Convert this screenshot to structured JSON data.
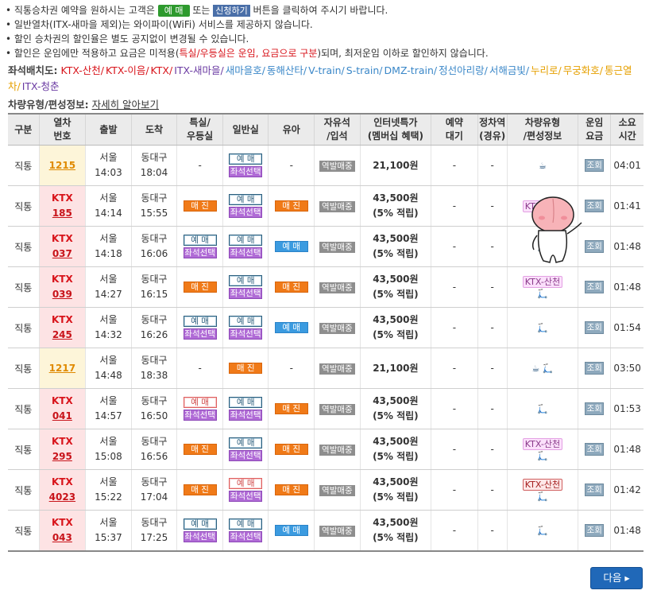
{
  "notices": [
    {
      "pre": "• 직통승차권 예약을 원하시는 고객은 ",
      "chip1": "예 매",
      "mid": " 또는 ",
      "chip2": "신청하기",
      "post": " 버튼을 클릭하여 주시기 바랍니다."
    },
    {
      "text": "• 일반열차(ITX-새마을 제외)는 와이파이(WiFi) 서비스를 제공하지 않습니다."
    },
    {
      "text": "• 할인 승차권의 할인율은 별도 공지없이 변경될 수 있습니다."
    },
    {
      "pre": "• 할인은 운임에만 적용하고 요금은 미적용(",
      "red": "특실/우등실은 운임, 요금으로 구분",
      "post": ")되며, 최저운임 이하로 할인하지 않습니다."
    }
  ],
  "seat_map": {
    "label": "좌석배치도:",
    "links": [
      {
        "text": "KTX-산천/",
        "color": "#d8131a"
      },
      {
        "text": "KTX-이음/",
        "color": "#d8131a"
      },
      {
        "text": "KTX/",
        "color": "#d8131a"
      },
      {
        "text": "ITX-새마을/",
        "color": "#6a3aa2"
      },
      {
        "text": "새마을호/",
        "color": "#3a87c8"
      },
      {
        "text": "동해산타/",
        "color": "#3a87c8"
      },
      {
        "text": "V-train/",
        "color": "#3a87c8"
      },
      {
        "text": "S-train/",
        "color": "#3a87c8"
      },
      {
        "text": "DMZ-train/",
        "color": "#3a87c8"
      },
      {
        "text": "정선아리랑/",
        "color": "#3a87c8"
      },
      {
        "text": "서해금빛/",
        "color": "#3a87c8"
      },
      {
        "text": "누리로/",
        "color": "#e6a000"
      },
      {
        "text": "무궁화호/",
        "color": "#e6a000"
      },
      {
        "text": "통근열차/",
        "color": "#e6a000"
      },
      {
        "text": "ITX-청춘",
        "color": "#6a3aa2"
      }
    ]
  },
  "train_info": {
    "label": "차량유형/편성정보:",
    "link": "자세히 알아보기"
  },
  "headers": [
    [
      "구분",
      ""
    ],
    [
      "열차",
      "번호"
    ],
    [
      "출발",
      ""
    ],
    [
      "도착",
      ""
    ],
    [
      "특실/",
      "우등실"
    ],
    [
      "일반실",
      ""
    ],
    [
      "유아",
      ""
    ],
    [
      "자유석",
      "/입석"
    ],
    [
      "인터넷특가",
      "(멤버십 혜택)"
    ],
    [
      "예약",
      "대기"
    ],
    [
      "정차역",
      "(경유)"
    ],
    [
      "차량유형",
      "/편성정보"
    ],
    [
      "운임",
      "요금"
    ],
    [
      "소요",
      "시간"
    ]
  ],
  "rows": [
    {
      "type": "직통",
      "cls": "itx",
      "t1": "",
      "t2": "1215",
      "dep_st": "서울",
      "dep": "14:03",
      "arr_st": "동대구",
      "arr": "18:04",
      "special": "-",
      "normal": "yemae-seat",
      "infant": "-",
      "free": "역발매중",
      "fare": "21,100원",
      "fare2": "",
      "wait": "-",
      "stops": "-",
      "veh_tag": "",
      "veh_icons": "☕",
      "fee": "조회",
      "time": "04:01"
    },
    {
      "type": "직통",
      "cls": "",
      "t1": "KTX",
      "t2": "185",
      "dep_st": "서울",
      "dep": "14:14",
      "arr_st": "동대구",
      "arr": "15:55",
      "special": "maejin",
      "normal": "yemae-seat",
      "infant": "maejin",
      "free": "역발매중",
      "fare": "43,500원",
      "fare2": "(5% 적립)",
      "wait": "-",
      "stops": "-",
      "veh_tag": "KTX-산천",
      "veh_icons": "",
      "fee": "조회",
      "time": "01:41"
    },
    {
      "type": "직통",
      "cls": "",
      "t1": "KTX",
      "t2": "037",
      "dep_st": "서울",
      "dep": "14:18",
      "arr_st": "동대구",
      "arr": "16:06",
      "special": "yemae-seat",
      "normal": "yemae-seat",
      "infant": "blue",
      "free": "역발매중",
      "fare": "43,500원",
      "fare2": "(5% 적립)",
      "wait": "-",
      "stops": "-",
      "veh_tag": "",
      "veh_icons": "🛴",
      "fee": "조회",
      "time": "01:48"
    },
    {
      "type": "직통",
      "cls": "",
      "t1": "KTX",
      "t2": "039",
      "dep_st": "서울",
      "dep": "14:27",
      "arr_st": "동대구",
      "arr": "16:15",
      "special": "maejin",
      "normal": "yemae-seat",
      "infant": "maejin",
      "free": "역발매중",
      "fare": "43,500원",
      "fare2": "(5% 적립)",
      "wait": "-",
      "stops": "-",
      "veh_tag": "KTX-산천",
      "veh_icons": "🛴",
      "fee": "조회",
      "time": "01:48"
    },
    {
      "type": "직통",
      "cls": "",
      "t1": "KTX",
      "t2": "245",
      "dep_st": "서울",
      "dep": "14:32",
      "arr_st": "동대구",
      "arr": "16:26",
      "special": "yemae-seat",
      "normal": "yemae-seat",
      "infant": "blue",
      "free": "역발매중",
      "fare": "43,500원",
      "fare2": "(5% 적립)",
      "wait": "-",
      "stops": "-",
      "veh_tag": "",
      "veh_icons": "🛴",
      "fee": "조회",
      "time": "01:54"
    },
    {
      "type": "직통",
      "cls": "itx",
      "t1": "",
      "t2": "1217",
      "dep_st": "서울",
      "dep": "14:48",
      "arr_st": "동대구",
      "arr": "18:38",
      "special": "-",
      "normal": "maejin",
      "infant": "-",
      "free": "역발매중",
      "fare": "21,100원",
      "fare2": "",
      "wait": "-",
      "stops": "-",
      "veh_tag": "",
      "veh_icons": "☕ 🛴",
      "fee": "조회",
      "time": "03:50"
    },
    {
      "type": "직통",
      "cls": "",
      "t1": "KTX",
      "t2": "041",
      "dep_st": "서울",
      "dep": "14:57",
      "arr_st": "동대구",
      "arr": "16:50",
      "special": "yemae-red-seat",
      "normal": "yemae-seat",
      "infant": "maejin",
      "free": "역발매중",
      "fare": "43,500원",
      "fare2": "(5% 적립)",
      "wait": "-",
      "stops": "-",
      "veh_tag": "",
      "veh_icons": "🛴",
      "fee": "조회",
      "time": "01:53"
    },
    {
      "type": "직통",
      "cls": "",
      "t1": "KTX",
      "t2": "295",
      "dep_st": "서울",
      "dep": "15:08",
      "arr_st": "동대구",
      "arr": "16:56",
      "special": "maejin",
      "normal": "yemae-seat",
      "infant": "maejin",
      "free": "역발매중",
      "fare": "43,500원",
      "fare2": "(5% 적립)",
      "wait": "-",
      "stops": "-",
      "veh_tag": "KTX-산천",
      "veh_icons": "🛴",
      "fee": "조회",
      "time": "01:48"
    },
    {
      "type": "직통",
      "cls": "",
      "t1": "KTX",
      "t2": "4023",
      "dep_st": "서울",
      "dep": "15:22",
      "arr_st": "동대구",
      "arr": "17:04",
      "special": "maejin",
      "normal": "yemae-red-seat",
      "infant": "maejin",
      "free": "역발매중",
      "fare": "43,500원",
      "fare2": "(5% 적립)",
      "wait": "-",
      "stops": "-",
      "veh_tag": "KTX-산천",
      "veh_tag_red": true,
      "veh_icons": "🛴",
      "fee": "조회",
      "time": "01:42"
    },
    {
      "type": "직통",
      "cls": "",
      "t1": "KTX",
      "t2": "043",
      "dep_st": "서울",
      "dep": "15:37",
      "arr_st": "동대구",
      "arr": "17:25",
      "special": "yemae-seat",
      "normal": "yemae-seat",
      "infant": "blue",
      "free": "역발매중",
      "fare": "43,500원",
      "fare2": "(5% 적립)",
      "wait": "-",
      "stops": "-",
      "veh_tag": "",
      "veh_icons": "🛴",
      "fee": "조회",
      "time": "01:48"
    }
  ],
  "labels": {
    "yemae": "예 매",
    "seat": "좌석선택",
    "maejin": "매 진"
  },
  "next_button": "다음 ▸"
}
